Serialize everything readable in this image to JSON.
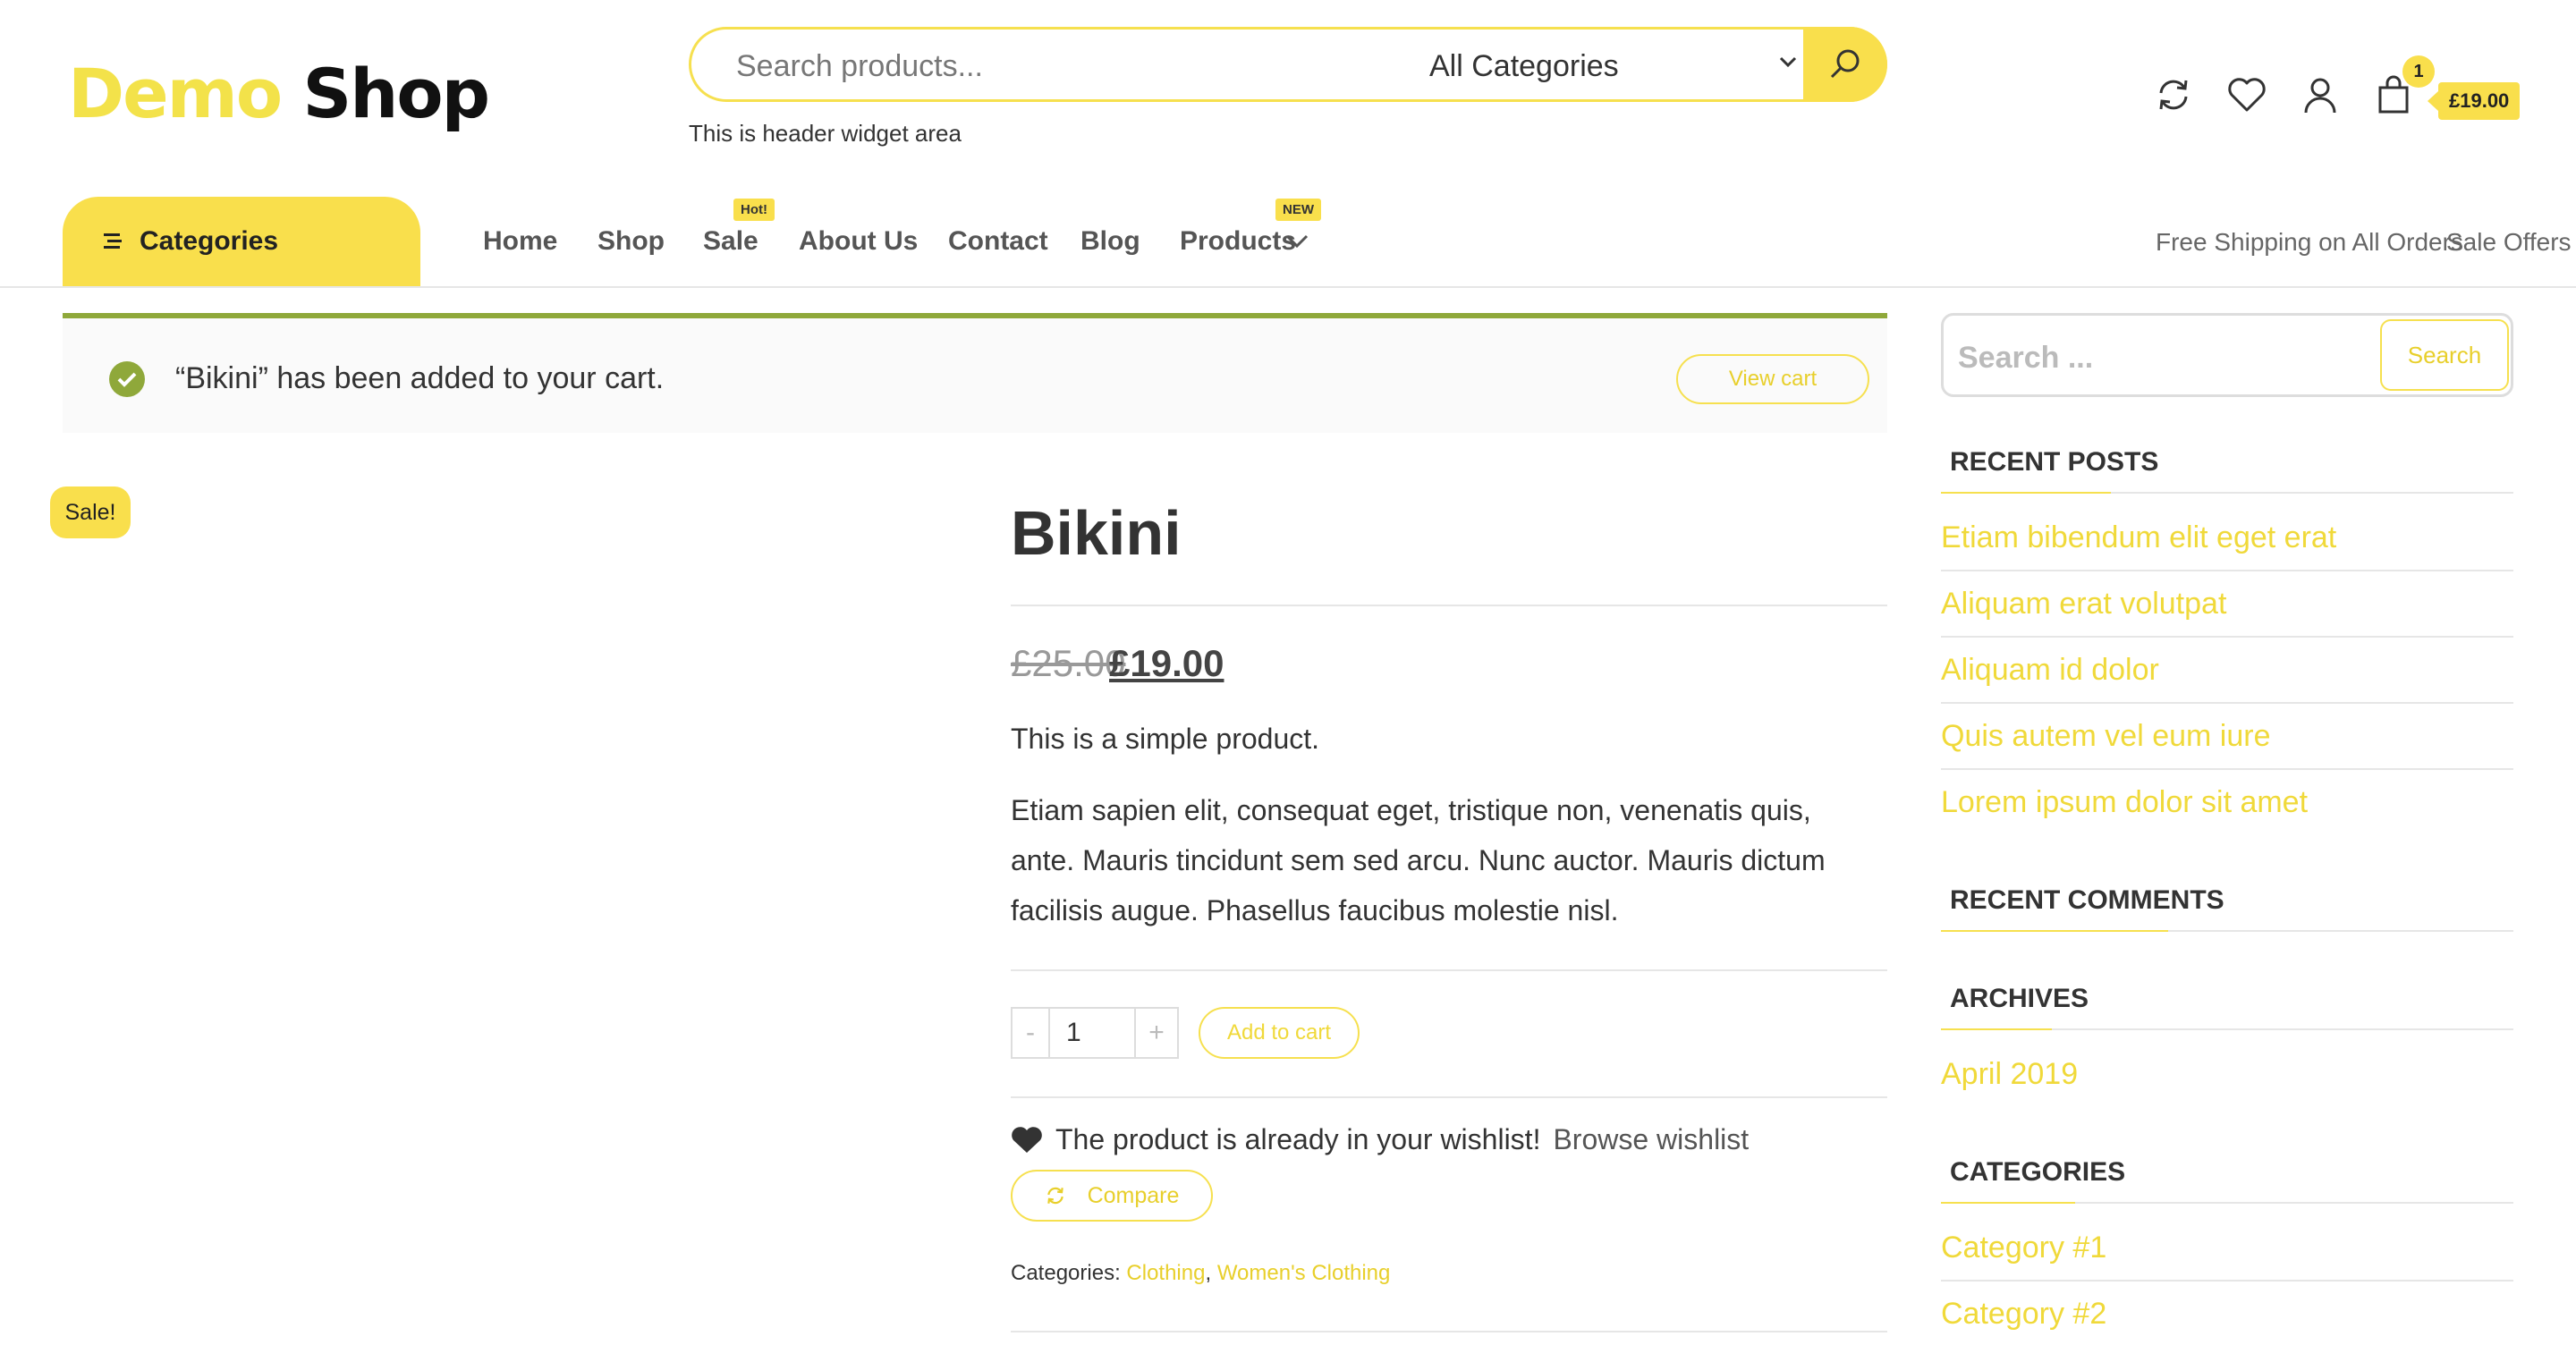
{
  "header": {
    "logo_part1": "Demo",
    "logo_part2": "Shop",
    "search_placeholder": "Search products...",
    "category_select": "All Categories",
    "widget_text": "This is header widget area",
    "cart_count": "1",
    "cart_total": "£19.00",
    "icons": [
      "refresh-icon",
      "heart-icon",
      "user-icon",
      "bag-icon",
      "search-icon"
    ]
  },
  "nav": {
    "categories_label": "Categories",
    "items": [
      {
        "label": "Home"
      },
      {
        "label": "Shop"
      },
      {
        "label": "Sale",
        "badge": "Hot!"
      },
      {
        "label": "About Us"
      },
      {
        "label": "Contact"
      },
      {
        "label": "Blog"
      },
      {
        "label": "Products",
        "badge": "NEW"
      }
    ],
    "right_links": [
      "Free Shipping on All Orders",
      "Sale Offers"
    ]
  },
  "notice": {
    "message": "“Bikini” has been added to your cart.",
    "view_cart": "View cart"
  },
  "product": {
    "sale_badge": "Sale!",
    "title": "Bikini",
    "old_price": "£25.00",
    "new_price": "£19.00",
    "short_description": "This is a simple product.",
    "description": "Etiam sapien elit, consequat eget, tristique non, venenatis quis, ante. Mauris tincidunt sem sed arcu. Nunc auctor. Mauris dictum facilisis augue. Phasellus faucibus molestie nisl.",
    "qty_minus": "-",
    "quantity": "1",
    "qty_plus": "+",
    "add_to_cart": "Add to cart",
    "wishlist_text": "The product is already in your wishlist!",
    "browse_wishlist": "Browse wishlist",
    "compare": "Compare",
    "categories_label": "Categories:",
    "categories": [
      "Clothing",
      "Women's Clothing"
    ],
    "categories_sep": ","
  },
  "sidebar": {
    "search_placeholder": "Search ...",
    "search_button": "Search",
    "recent_posts_title": "RECENT POSTS",
    "recent_posts": [
      "Etiam bibendum elit eget erat",
      "Aliquam erat volutpat",
      "Aliquam id dolor",
      "Quis autem vel eum iure",
      "Lorem ipsum dolor sit amet"
    ],
    "recent_comments_title": "RECENT COMMENTS",
    "archives_title": "ARCHIVES",
    "archives": [
      "April 2019"
    ],
    "categories_title": "CATEGORIES",
    "categories": [
      "Category #1",
      "Category #2"
    ]
  },
  "colors": {
    "accent_yellow": "#f9df4c",
    "success_green": "#8fa83a"
  }
}
